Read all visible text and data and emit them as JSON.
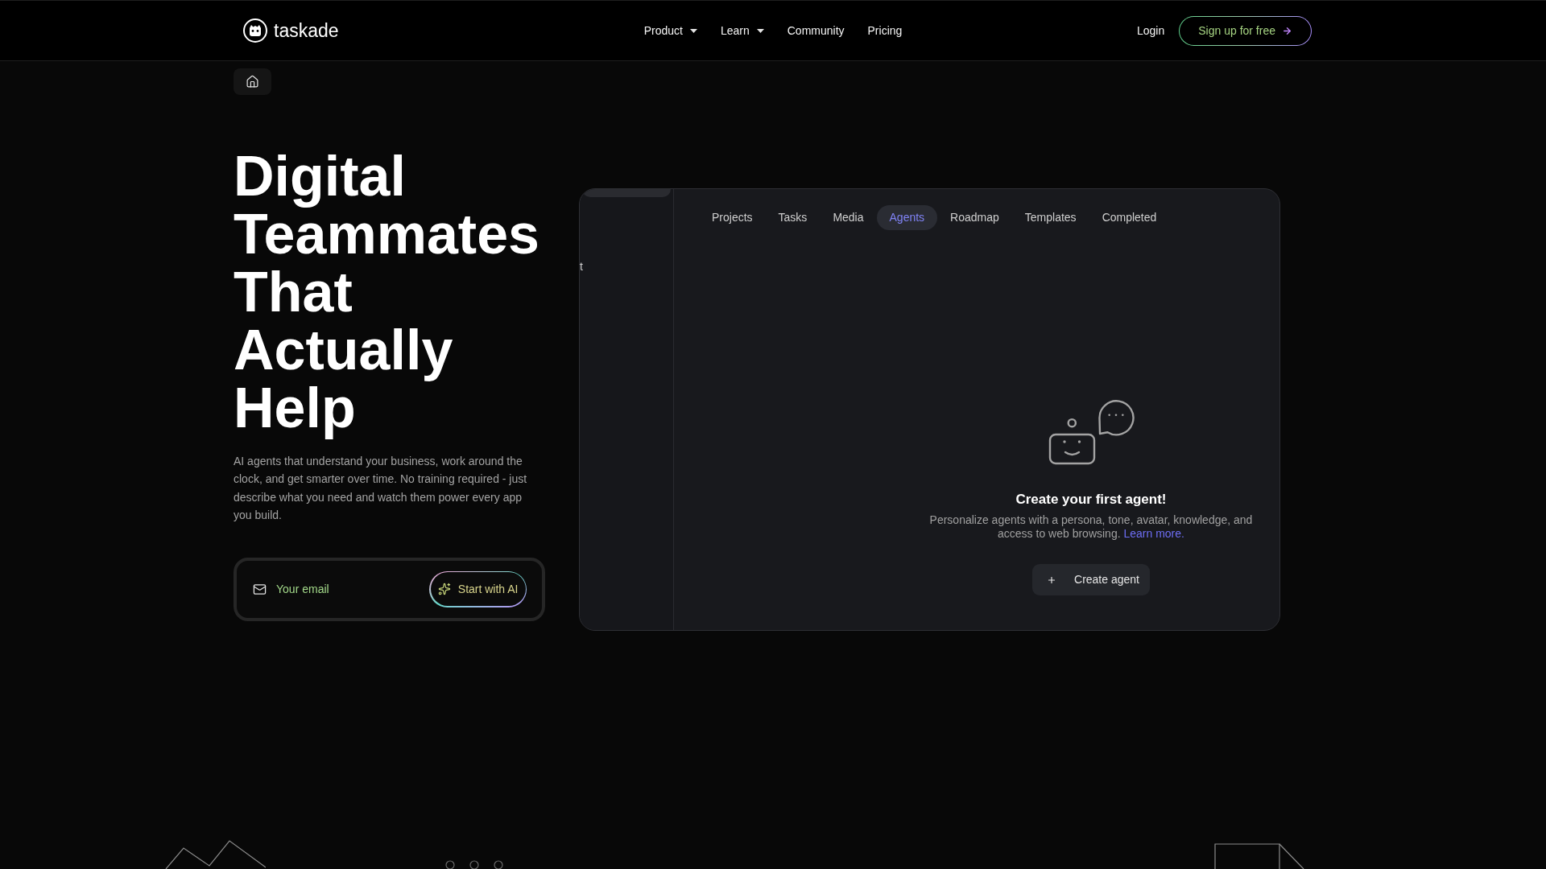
{
  "nav": {
    "logo_text": "taskade",
    "links": [
      {
        "label": "Product",
        "kind": "dropdown"
      },
      {
        "label": "Learn",
        "kind": "dropdown"
      },
      {
        "label": "Community",
        "kind": "link"
      },
      {
        "label": "Pricing",
        "kind": "link"
      }
    ],
    "login": "Login",
    "signup": "Sign up for free"
  },
  "hero": {
    "title": "Digital Teammates That Actually Help",
    "description": "AI agents that understand your business, work around the clock, and get smarter over time. No training required - just describe what you need and watch them power every app you build.",
    "email_form": {
      "placeholder": "Your email",
      "button": "Start with AI"
    }
  },
  "app_preview": {
    "sidebar": {
      "partial_label": "t"
    },
    "tabs": [
      {
        "label": "Projects",
        "selected": false
      },
      {
        "label": "Tasks",
        "selected": false
      },
      {
        "label": "Media",
        "selected": false
      },
      {
        "label": "Agents",
        "selected": true
      },
      {
        "label": "Roadmap",
        "selected": false
      },
      {
        "label": "Templates",
        "selected": false
      },
      {
        "label": "Completed",
        "selected": false
      }
    ],
    "empty_state": {
      "title": "Create your first agent!",
      "description": "Personalize agents with a persona, tone, avatar, knowledge, and access to web browsing.",
      "link": "Learn more.",
      "button": "Create agent"
    }
  }
}
